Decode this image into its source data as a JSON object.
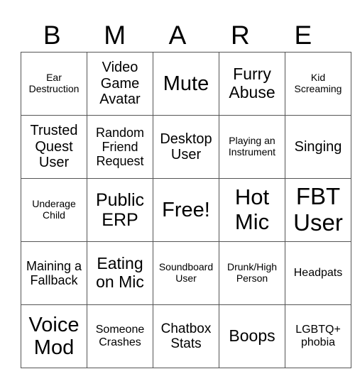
{
  "header": [
    "B",
    "M",
    "A",
    "R",
    "E"
  ],
  "cells": [
    [
      "Ear Destruction",
      "Video Game Avatar",
      "Mute",
      "Furry Abuse",
      "Kid Screaming"
    ],
    [
      "Trusted Quest User",
      "Random Friend Request",
      "Desktop User",
      "Playing an Instrument",
      "Singing"
    ],
    [
      "Underage Child",
      "Public ERP",
      "Free!",
      "Hot Mic",
      "FBT User"
    ],
    [
      "Maining a Fallback",
      "Eating on Mic",
      "Soundboard User",
      "Drunk/High Person",
      "Headpats"
    ],
    [
      "Voice Mod",
      "Someone Crashes",
      "Chatbox Stats",
      "Boops",
      "LGBTQ+ phobia"
    ]
  ]
}
